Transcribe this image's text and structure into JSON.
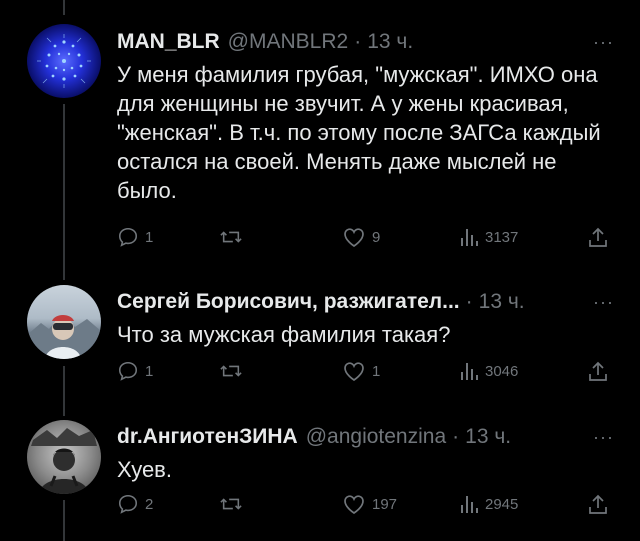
{
  "tweets": [
    {
      "name": "MAN_BLR",
      "handle": "@MANBLR2",
      "time": "13 ч.",
      "more": "···",
      "text": "У меня фамилия грубая, \"мужская\". ИМХО она для женщины не звучит. А у жены красивая, \"женская\". В т.ч. по этому после ЗАГСа каждый остался на своей. Менять даже мыслей не было.",
      "replies": "1",
      "retweets": "",
      "likes": "9",
      "views": "3137"
    },
    {
      "name": "Сергей Борисович, разжигател...",
      "handle": "",
      "time": "13 ч.",
      "more": "···",
      "text": "Что за мужская фамилия такая?",
      "replies": "1",
      "retweets": "",
      "likes": "1",
      "views": "3046"
    },
    {
      "name": "dr.АнгиотенЗИНА",
      "handle": "@angiotenzina",
      "time": "13 ч.",
      "more": "···",
      "text": "Хуев.",
      "replies": "2",
      "retweets": "",
      "likes": "197",
      "views": "2945"
    }
  ],
  "colors": {
    "text": "#e7e9ea",
    "muted": "#71767b",
    "background": "#000000"
  },
  "icons": [
    "reply-icon",
    "retweet-icon",
    "like-icon",
    "views-icon",
    "share-icon"
  ]
}
